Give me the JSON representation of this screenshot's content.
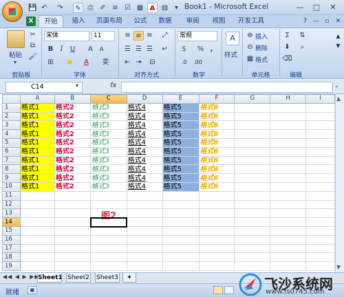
{
  "window": {
    "title": "Book1 - Microsoft Excel",
    "controls": {
      "minimize": "—",
      "maximize": "□",
      "close": "✕"
    }
  },
  "quick_access": {
    "save": "💾",
    "undo": "↶",
    "redo": "↷"
  },
  "ribbon_tabs": [
    "开始",
    "插入",
    "页面布局",
    "公式",
    "数据",
    "审阅",
    "视图",
    "开发工具"
  ],
  "ribbon": {
    "paste_label": "粘贴",
    "font_name": "宋体",
    "font_size": "11",
    "number_format": "常规",
    "styles_label": "样式",
    "insert_label": "插入",
    "delete_label": "删除",
    "format_label": "格式",
    "groups": [
      "剪贴板",
      "字体",
      "对齐方式",
      "数字",
      "单元格",
      "编辑"
    ]
  },
  "formula_bar": {
    "name_box": "C14",
    "fx": "fx",
    "value": ""
  },
  "grid": {
    "columns": [
      "A",
      "B",
      "C",
      "D",
      "E",
      "F",
      "G",
      "H",
      "I"
    ],
    "selected_column": "C",
    "selected_row": 14,
    "row_count": 19,
    "data_rows": 10,
    "cells": {
      "A": "格式1",
      "B": "格式2",
      "C": "格式3",
      "D": "格式4",
      "E": "格式5",
      "F": "格式6"
    }
  },
  "annotation": "图2",
  "sheet_tabs": [
    "Sheet1",
    "Sheet2",
    "Sheet3"
  ],
  "status": {
    "ready": "就绪"
  },
  "watermark": {
    "text": "飞沙系统网",
    "url": "www.fs0745.com"
  }
}
